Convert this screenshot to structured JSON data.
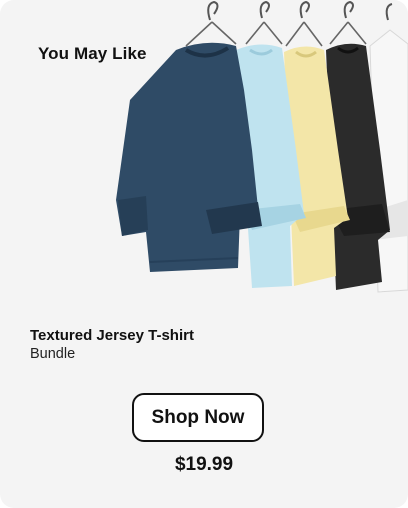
{
  "card": {
    "title": "You May Like",
    "product": {
      "name": "Textured Jersey T-shirt",
      "subtitle": "Bundle",
      "price": "$19.99"
    },
    "cta_label": "Shop Now",
    "image": {
      "subject": "tshirts-on-hangers",
      "shirt_colors": [
        "#2f4b66",
        "#bde3ef",
        "#f4eab0",
        "#2a2a2a",
        "#f7f7f7"
      ]
    }
  }
}
